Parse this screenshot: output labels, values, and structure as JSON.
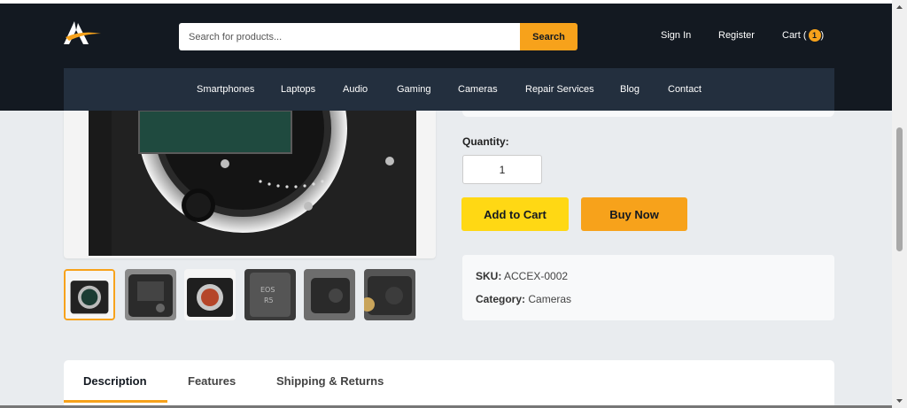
{
  "header": {
    "search_placeholder": "Search for products...",
    "search_button": "Search",
    "sign_in": "Sign In",
    "register": "Register",
    "cart_label": "Cart (",
    "cart_count": "1",
    "cart_close": ")"
  },
  "nav": {
    "items": [
      "Smartphones",
      "Laptops",
      "Audio",
      "Gaming",
      "Cameras",
      "Repair Services",
      "Blog",
      "Contact"
    ]
  },
  "product": {
    "quantity_label": "Quantity:",
    "quantity_value": "1",
    "add_to_cart": "Add to Cart",
    "buy_now": "Buy Now",
    "sku_label": "SKU:",
    "sku_value": "ACCEX-0002",
    "category_label": "Category:",
    "category_value": "Cameras"
  },
  "tabs": [
    "Description",
    "Features",
    "Shipping & Returns"
  ],
  "colors": {
    "header_bg": "#131921",
    "nav_bg": "#232f3e",
    "accent": "#f7a21b",
    "cart_button": "#ffd814"
  },
  "icons": {
    "logo": "brand-logo-icon",
    "cart_badge": "cart-count-badge"
  }
}
